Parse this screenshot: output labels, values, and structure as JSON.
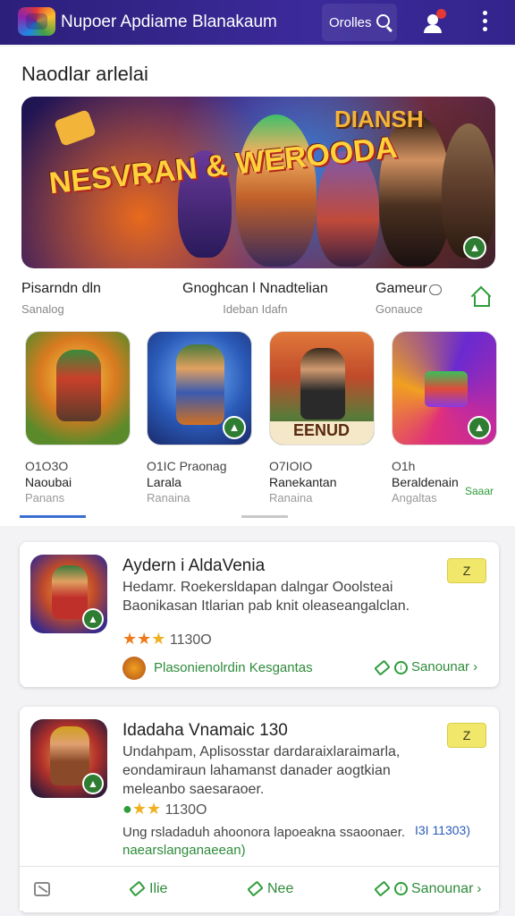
{
  "header": {
    "app_title": "Nupoer Apdiame Blanakaum",
    "search_label": "Orolles",
    "brand_color": "#2c1f7a"
  },
  "section": {
    "title": "Naodlar arlelai"
  },
  "banner": {
    "title_left": "NESVRAN & WEROODA",
    "title_right": "DIANSH"
  },
  "categories": [
    {
      "label": "Pisarndn dln",
      "sub": "Sanalog"
    },
    {
      "label": "Gnoghcan l Nnadtelian",
      "sub": "Ideban Idafn"
    },
    {
      "label": "Gameur",
      "sub": "Gonauce"
    }
  ],
  "tiles": [
    {
      "line1": "O1O3O",
      "line2": "Naoubai",
      "line3": "Panans"
    },
    {
      "line1": "O1IC Praonag",
      "line2": "Larala",
      "line3": "Ranaina"
    },
    {
      "line1": "O7IOIO",
      "line2": "Ranekantan",
      "line3": "Ranaina",
      "stamp": "EENUD"
    },
    {
      "line1": "O1h",
      "line2": "Beraldenain",
      "line3": "Angaltas",
      "extra": "Saaar"
    }
  ],
  "cards": [
    {
      "title": "Aydern i AldaVenia",
      "desc": "Hedamr. Roekersldapan dalngar Ooolsteai Baonikasan Itlarian pab knit oleaseangalclan.",
      "rating": "1130O",
      "get_label": "Z",
      "developer": "Plasonienolrdin Kesgantas",
      "link": "Sanounar"
    },
    {
      "title": "Idadaha Vnamaic 130",
      "desc": "Undahpam, Aplisosstar dardaraixlaraimarla, eondamiraun lahamanst danader aogtkian meleanbo saesaraoer.",
      "rating": "1130O",
      "get_label": "Z",
      "promo": "Ung rsladaduh ahoonora lapoeakna ssaoonaer.",
      "promo_price": "I3I 11303)",
      "developer": "naearslanganaeean)"
    }
  ],
  "bottombar": {
    "item1": "Ilie",
    "item2": "Nee",
    "item3": "Sanounar"
  }
}
